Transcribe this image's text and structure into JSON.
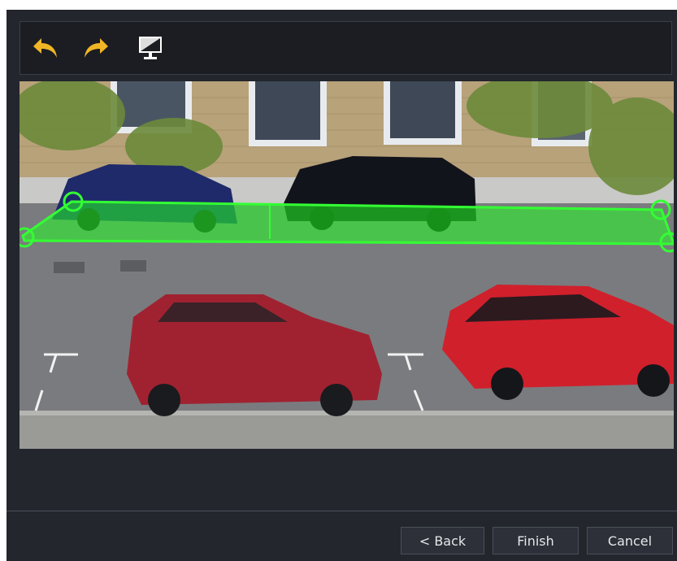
{
  "toolbar": {
    "undo_icon": "undo-arrow-icon",
    "redo_icon": "redo-arrow-icon",
    "monitor_icon": "monitor-icon",
    "icon_color": "#f0b625"
  },
  "zone": {
    "fill_color": "#22ff22",
    "fill_opacity": 0.55,
    "handle_color": "#33ff33"
  },
  "buttons": {
    "back": "< Back",
    "finish": "Finish",
    "cancel": "Cancel"
  }
}
